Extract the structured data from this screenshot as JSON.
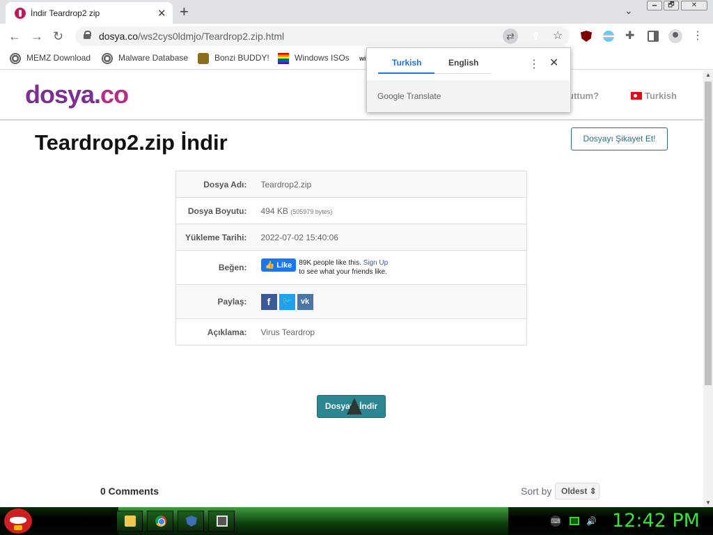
{
  "browser": {
    "tab_title": "İndir Teardrop2 zip",
    "tab_close": "✕",
    "new_tab": "+",
    "url_domain": "dosya.co",
    "url_path": "/ws2cys0ldmjo/Teardrop2.zip.html",
    "window_min": "🗕",
    "window_max": "🗗",
    "window_close": "✕"
  },
  "bookmarks": [
    {
      "label": "MEMZ Download",
      "icon": "globe-icon"
    },
    {
      "label": "Malware Database",
      "icon": "globe-icon"
    },
    {
      "label": "Bonzi BUDDY!",
      "icon": "bonzi-icon"
    },
    {
      "label": "Windows ISOs",
      "icon": "rainbow-flag-icon"
    },
    {
      "label": "wi",
      "icon": ""
    }
  ],
  "translate_popup": {
    "tab_source": "Turkish",
    "tab_target": "English",
    "footer_google": "Google",
    "footer_translate": "Translate",
    "more": "⋮",
    "close": "✕"
  },
  "site": {
    "logo_main": "dosya.",
    "logo_co": "co",
    "header_link": "uttum?",
    "language": "Turkish",
    "page_title": "Teardrop2.zip İndir",
    "report_button": "Dosyayı Şikayet Et!",
    "download_button": "Dosyayı İndir",
    "comments_count": "0 Comments",
    "sort_by_label": "Sort by",
    "sort_value": "Oldest"
  },
  "file_info": {
    "name_label": "Dosya Adı:",
    "name_value": "Teardrop2.zip",
    "size_label": "Dosya Boyutu:",
    "size_value": "494 KB",
    "size_bytes": "(505979 bytes)",
    "date_label": "Yükleme Tarihi:",
    "date_value": "2022-07-02 15:40:06",
    "like_label": "Beğen:",
    "fb_like": "Like",
    "fb_text_1": "89K people like this.",
    "fb_signup": "Sign Up",
    "fb_text_2": "to see what your friends like.",
    "share_label": "Paylaş:",
    "desc_label": "Açıklama:",
    "desc_value": "Virus Teardrop"
  },
  "taskbar": {
    "clock": "12:42 PM"
  },
  "colors": {
    "accent_button": "#2a8791",
    "logo_purple": "#7b2f91",
    "clock_green": "#3be23b"
  }
}
